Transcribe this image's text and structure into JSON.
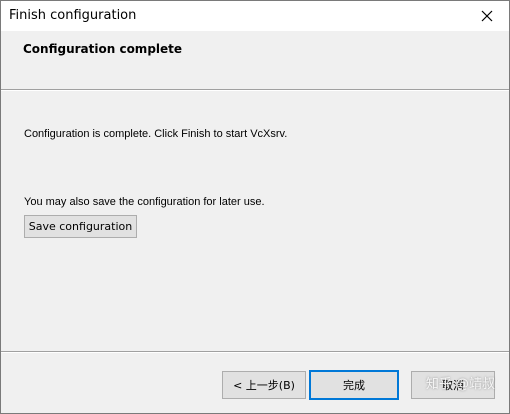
{
  "window": {
    "title": "Finish configuration"
  },
  "header": {
    "title": "Configuration complete"
  },
  "body": {
    "message": "Configuration is complete. Click Finish to start VcXsrv.",
    "save_hint": "You may also save the configuration for later use.",
    "save_button_label": "Save configuration"
  },
  "footer": {
    "back_label": "< 上一步(B)",
    "finish_label": "完成",
    "cancel_label": "取消"
  },
  "watermark": {
    "text": "知乎 @靖叔"
  },
  "colors": {
    "accent": "#0078d7",
    "window_bg": "#f0f0f0",
    "titlebar_bg": "#ffffff"
  },
  "icons": {
    "close": "close-icon"
  }
}
